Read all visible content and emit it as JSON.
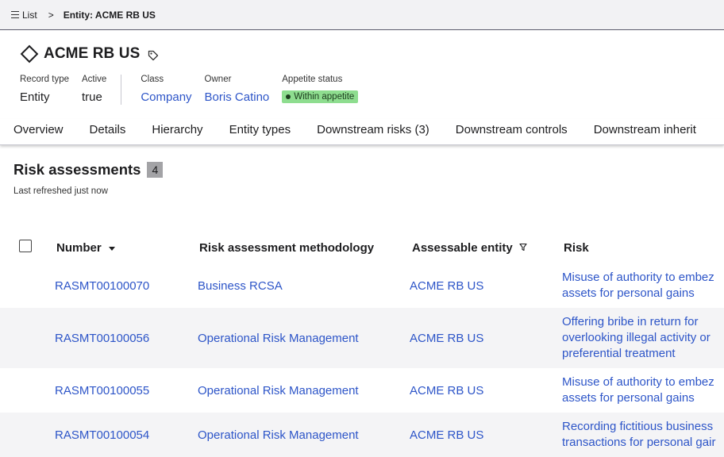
{
  "breadcrumb": {
    "list_label": "List",
    "separator": ">",
    "current": "Entity: ACME RB US"
  },
  "record": {
    "title": "ACME RB US",
    "fields": {
      "record_type_label": "Record type",
      "record_type_value": "Entity",
      "active_label": "Active",
      "active_value": "true",
      "class_label": "Class",
      "class_value": "Company",
      "owner_label": "Owner",
      "owner_value": "Boris Catino",
      "appetite_label": "Appetite status",
      "appetite_value": "Within appetite"
    }
  },
  "tabs": [
    {
      "label": "Overview"
    },
    {
      "label": "Details"
    },
    {
      "label": "Hierarchy"
    },
    {
      "label": "Entity types"
    },
    {
      "label": "Downstream risks (3)"
    },
    {
      "label": "Downstream controls"
    },
    {
      "label": "Downstream inherit"
    }
  ],
  "section": {
    "title": "Risk assessments",
    "count": "4",
    "refreshed": "Last refreshed just now"
  },
  "table": {
    "columns": {
      "number": "Number",
      "methodology": "Risk assessment methodology",
      "entity": "Assessable entity",
      "risk": "Risk"
    },
    "rows": [
      {
        "number": "RASMT00100070",
        "methodology": "Business RCSA",
        "entity": "ACME RB US",
        "risk_1": "Misuse of authority to embez",
        "risk_2": "assets for personal gains",
        "risk_3": ""
      },
      {
        "number": "RASMT00100056",
        "methodology": "Operational Risk Management",
        "entity": "ACME RB US",
        "risk_1": "Offering bribe in return for",
        "risk_2": "overlooking illegal activity or",
        "risk_3": "preferential treatment"
      },
      {
        "number": "RASMT00100055",
        "methodology": "Operational Risk Management",
        "entity": "ACME RB US",
        "risk_1": "Misuse of authority to embez",
        "risk_2": "assets for personal gains",
        "risk_3": ""
      },
      {
        "number": "RASMT00100054",
        "methodology": "Operational Risk Management",
        "entity": "ACME RB US",
        "risk_1": "Recording fictitious business",
        "risk_2": "transactions for personal gair",
        "risk_3": ""
      }
    ]
  },
  "colors": {
    "link": "#2d55c8",
    "badge_bg": "#8edd8f",
    "row_alt": "#f4f4f6"
  }
}
